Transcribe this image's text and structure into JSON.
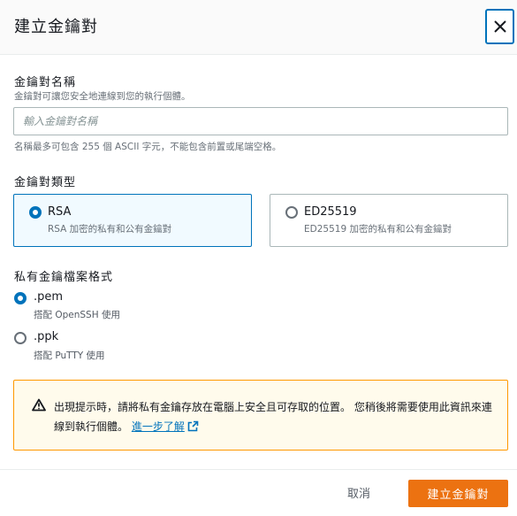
{
  "dialog": {
    "title": "建立金鑰對",
    "close_icon": "close-icon"
  },
  "name_field": {
    "label": "金鑰對名稱",
    "description": "金鑰對可讓您安全地連線到您的執行個體。",
    "placeholder": "輸入金鑰對名稱",
    "value": "",
    "constraint": "名稱最多可包含 255 個 ASCII 字元，不能包含前置或尾端空格。"
  },
  "key_type": {
    "label": "金鑰對類型",
    "options": [
      {
        "title": "RSA",
        "description": "RSA 加密的私有和公有金鑰對",
        "selected": true
      },
      {
        "title": "ED25519",
        "description": "ED25519 加密的私有和公有金鑰對",
        "selected": false
      }
    ]
  },
  "file_format": {
    "label": "私有金鑰檔案格式",
    "options": [
      {
        "title": ".pem",
        "description": "搭配 OpenSSH 使用",
        "selected": true
      },
      {
        "title": ".ppk",
        "description": "搭配 PuTTY 使用",
        "selected": false
      }
    ]
  },
  "alert": {
    "icon": "warning-icon",
    "text": "出現提示時，請將私有金鑰存放在電腦上安全且可存取的位置。 您稍後將需要使用此資訊來連線到執行個體。",
    "link_label": "進一步了解",
    "link_icon": "external-link-icon"
  },
  "footer": {
    "cancel_label": "取消",
    "submit_label": "建立金鑰對"
  },
  "colors": {
    "accent": "#0073bb",
    "primary_button": "#ec7211",
    "warning_border": "#ff9900",
    "warning_bg": "#fffbec"
  }
}
